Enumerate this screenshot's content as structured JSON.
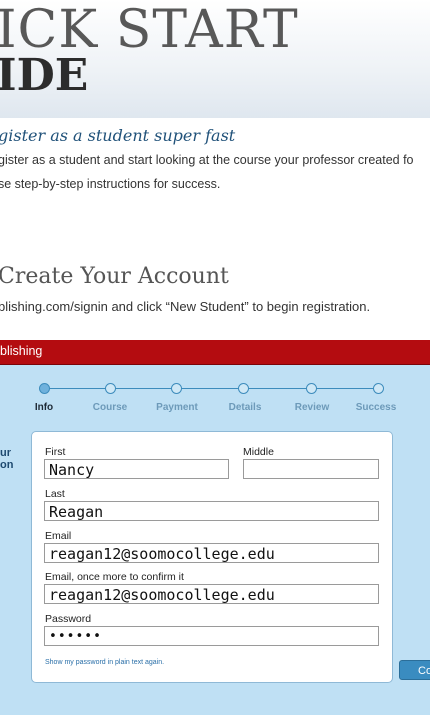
{
  "hero": {
    "title_line1": "ICK START",
    "title_line2": "IDE"
  },
  "intro": {
    "heading": "gister as a student super fast",
    "line1": "gister as a student and start looking at the course your professor created fo",
    "line2": "se step-by-step instructions for success."
  },
  "step": {
    "title": "Create Your Account",
    "description": "blishing.com/signin and click “New Student” to begin registration."
  },
  "app": {
    "header": "blishing",
    "side_label_1": "ur",
    "side_label_2": "on",
    "steps": [
      {
        "label": "Info",
        "active": true
      },
      {
        "label": "Course",
        "active": false
      },
      {
        "label": "Payment",
        "active": false
      },
      {
        "label": "Details",
        "active": false
      },
      {
        "label": "Review",
        "active": false
      },
      {
        "label": "Success",
        "active": false
      }
    ],
    "form": {
      "first_label": "First",
      "first_value": "Nancy",
      "middle_label": "Middle",
      "middle_value": "",
      "last_label": "Last",
      "last_value": "Reagan",
      "email_label": "Email",
      "email_value": "reagan12@soomocollege.edu",
      "email_confirm_label": "Email, once more to confirm it",
      "email_confirm_value": "reagan12@soomocollege.edu",
      "password_label": "Password",
      "password_value": "••••••",
      "show_password_link": "Show my password in plain text again."
    },
    "continue_label": "Co"
  },
  "colors": {
    "brand_red": "#b40c10",
    "panel_blue": "#bfe0f4",
    "accent_blue": "#3d8cbc",
    "heading_blue": "#21527a"
  }
}
